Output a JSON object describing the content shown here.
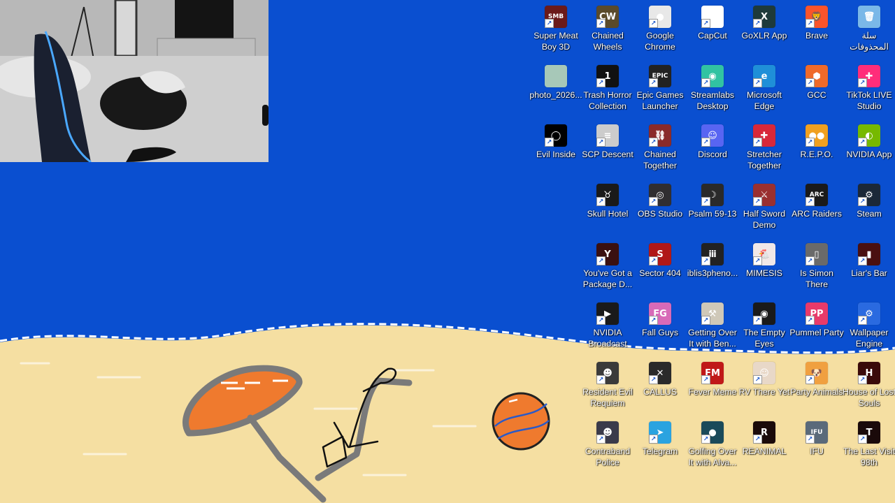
{
  "desktop": {
    "background_color": "#0a4fd0",
    "sand_color": "#f5dfa2",
    "umbrella_color": "#ef7a2e",
    "icons": [
      {
        "label": "Super Meat Boy 3D",
        "color": "#6b1a1a",
        "glyph": "SMB",
        "shortcut": true
      },
      {
        "label": "Chained Wheels",
        "color": "#5a4a2a",
        "glyph": "CW",
        "shortcut": true
      },
      {
        "label": "Google Chrome",
        "color": "#e8e8e8",
        "glyph": "●",
        "shortcut": true
      },
      {
        "label": "CapCut",
        "color": "#ffffff",
        "glyph": "✂",
        "shortcut": true
      },
      {
        "label": "GoXLR App",
        "color": "#1e3a3a",
        "glyph": "X",
        "shortcut": true
      },
      {
        "label": "Brave",
        "color": "#fb542b",
        "glyph": "🦁",
        "shortcut": true
      },
      {
        "label": "سلة المحذوفات",
        "color": "#7ab8e8",
        "glyph": "🗑",
        "shortcut": false
      },
      {
        "label": "photo_2026...",
        "color": "#a7c8b8",
        "glyph": "",
        "shortcut": false
      },
      {
        "label": "Trash Horror Collection",
        "color": "#111111",
        "glyph": "1",
        "shortcut": true
      },
      {
        "label": "Epic Games Launcher",
        "color": "#222222",
        "glyph": "EPIC",
        "shortcut": true
      },
      {
        "label": "Streamlabs Desktop",
        "color": "#31c3a2",
        "glyph": "◉",
        "shortcut": true
      },
      {
        "label": "Microsoft Edge",
        "color": "#1f8fd8",
        "glyph": "e",
        "shortcut": true
      },
      {
        "label": "GCC",
        "color": "#ef6a2a",
        "glyph": "⬢",
        "shortcut": true
      },
      {
        "label": "TikTok LIVE Studio",
        "color": "#ff2d7a",
        "glyph": "✚",
        "shortcut": true
      },
      {
        "label": "Evil Inside",
        "color": "#000000",
        "glyph": "◯",
        "shortcut": true
      },
      {
        "label": "SCP Descent",
        "color": "#cccccc",
        "glyph": "≡",
        "shortcut": true
      },
      {
        "label": "Chained Together",
        "color": "#8a2a2a",
        "glyph": "⛓",
        "shortcut": true
      },
      {
        "label": "Discord",
        "color": "#5865f2",
        "glyph": "☺",
        "shortcut": true
      },
      {
        "label": "Stretcher Together",
        "color": "#d8283a",
        "glyph": "✚",
        "shortcut": true
      },
      {
        "label": "R.E.P.O.",
        "color": "#f0a020",
        "glyph": "●●",
        "shortcut": true
      },
      {
        "label": "NVIDIA App",
        "color": "#76b900",
        "glyph": "◐",
        "shortcut": true
      },
      {
        "label": "Skull Hotel",
        "color": "#1a1a1a",
        "glyph": "♉",
        "shortcut": true
      },
      {
        "label": "OBS Studio",
        "color": "#302e31",
        "glyph": "◎",
        "shortcut": true
      },
      {
        "label": "Psalm 59-13",
        "color": "#2a2a2a",
        "glyph": "☽",
        "shortcut": true
      },
      {
        "label": "Half Sword Demo",
        "color": "#9a3030",
        "glyph": "⚔",
        "shortcut": true
      },
      {
        "label": "ARC Raiders",
        "color": "#1a1a1a",
        "glyph": "ARC",
        "shortcut": true
      },
      {
        "label": "Steam",
        "color": "#1b2838",
        "glyph": "⚙",
        "shortcut": true
      },
      {
        "label": "You've Got a Package D...",
        "color": "#3a1010",
        "glyph": "Y",
        "shortcut": true
      },
      {
        "label": "Sector 404",
        "color": "#b01818",
        "glyph": "S",
        "shortcut": true
      },
      {
        "label": "iblis3pheno...",
        "color": "#222222",
        "glyph": "ⅲ",
        "shortcut": true
      },
      {
        "label": "MIMESIS",
        "color": "#f0e8e8",
        "glyph": "🐔",
        "shortcut": true
      },
      {
        "label": "Is Simon There",
        "color": "#6a6a6a",
        "glyph": "▯",
        "shortcut": true
      },
      {
        "label": "Liar's Bar",
        "color": "#4a1010",
        "glyph": "▮",
        "shortcut": true
      },
      {
        "label": "NVIDIA Broadcast",
        "color": "#1a1a1a",
        "glyph": "▶",
        "shortcut": true
      },
      {
        "label": "Fall Guys",
        "color": "#d86ab8",
        "glyph": "FG",
        "shortcut": true
      },
      {
        "label": "Getting Over It with Ben...",
        "color": "#cfc8b8",
        "glyph": "⚒",
        "shortcut": true
      },
      {
        "label": "The Empty Eyes",
        "color": "#1a1a1a",
        "glyph": "◉",
        "shortcut": true
      },
      {
        "label": "Pummel Party",
        "color": "#e83a6a",
        "glyph": "PP",
        "shortcut": true
      },
      {
        "label": "Wallpaper Engine",
        "color": "#2a6ae0",
        "glyph": "⚙",
        "shortcut": true
      },
      {
        "label": "Resident Evil Requiem",
        "color": "#3a3a3a",
        "glyph": "☻",
        "shortcut": true
      },
      {
        "label": "CALLUS",
        "color": "#2a2a2a",
        "glyph": "✕",
        "shortcut": true
      },
      {
        "label": "Fever Meme",
        "color": "#c01818",
        "glyph": "FM",
        "shortcut": true
      },
      {
        "label": "RV There Yet",
        "color": "#e8d8c8",
        "glyph": "☺",
        "shortcut": true
      },
      {
        "label": "Party Animals",
        "color": "#f0a040",
        "glyph": "🐶",
        "shortcut": true
      },
      {
        "label": "House of Lost Souls",
        "color": "#3a0a0a",
        "glyph": "H",
        "shortcut": true
      },
      {
        "label": "Contraband Police",
        "color": "#3a3a4a",
        "glyph": "☻",
        "shortcut": true
      },
      {
        "label": "Telegram",
        "color": "#2aa3e0",
        "glyph": "➤",
        "shortcut": true
      },
      {
        "label": "Golfing Over It with Alva...",
        "color": "#1a4a5a",
        "glyph": "●",
        "shortcut": true
      },
      {
        "label": "REANIMAL",
        "color": "#1a0a0a",
        "glyph": "R",
        "shortcut": true
      },
      {
        "label": "IFU",
        "color": "#5a6a7a",
        "glyph": "IFU",
        "shortcut": true
      },
      {
        "label": "The Last Visit 98th",
        "color": "#1a0a0a",
        "glyph": "T",
        "shortcut": true
      }
    ]
  }
}
